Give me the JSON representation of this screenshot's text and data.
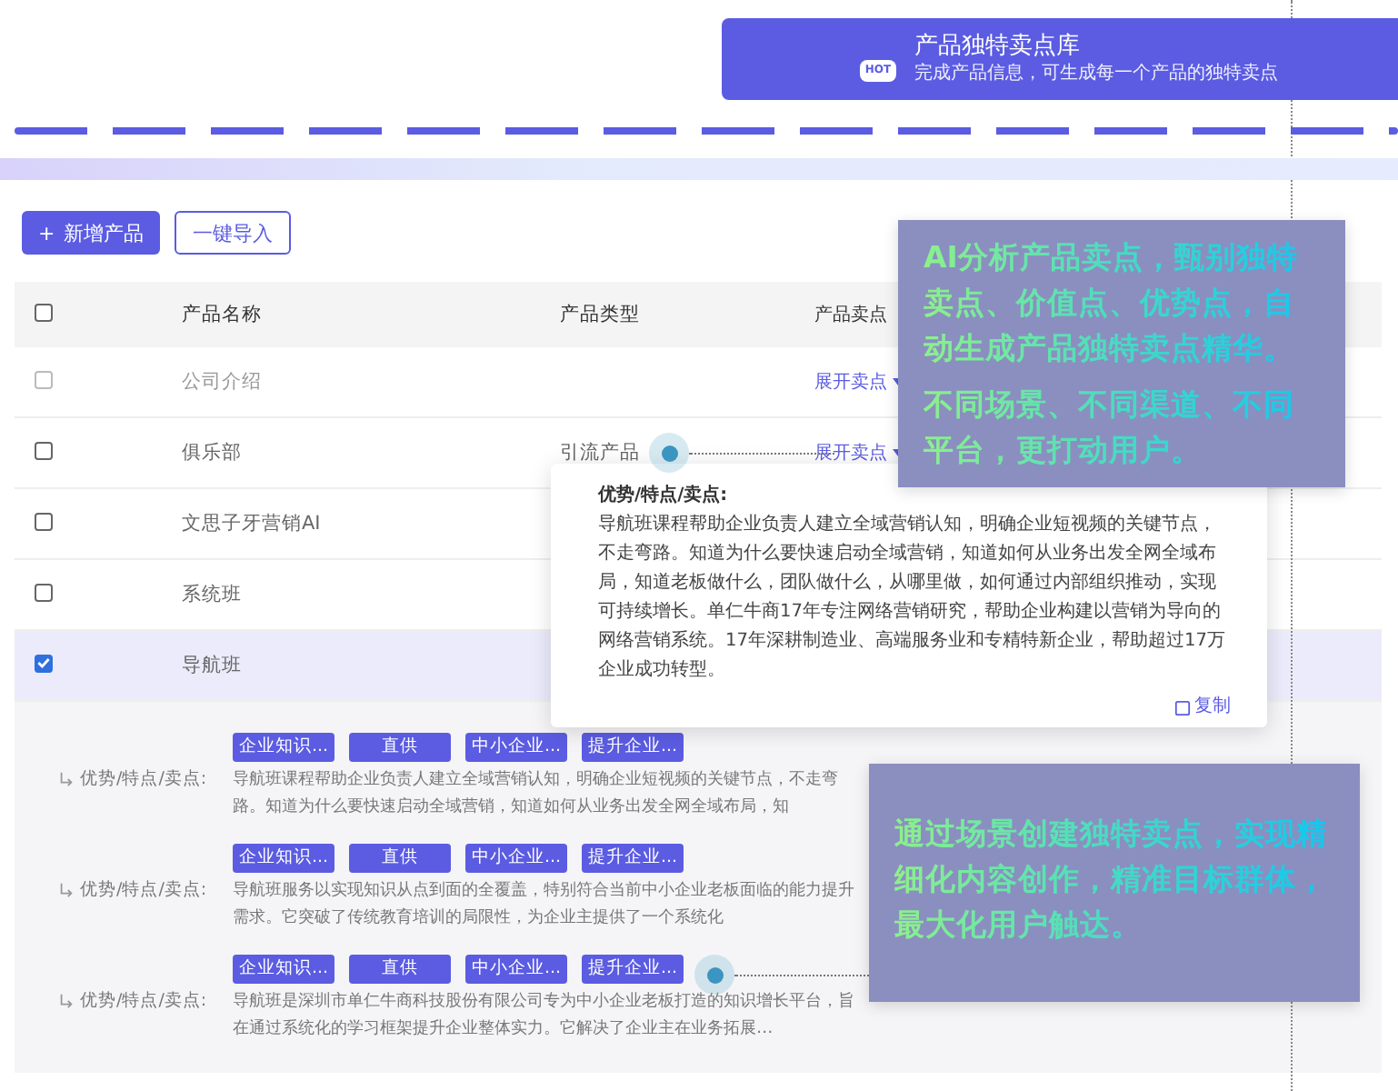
{
  "banner": {
    "title": "产品独特卖点库",
    "subtitle": "完成产品信息，可生成每一个产品的独特卖点",
    "badge": "HOT"
  },
  "toolbar": {
    "buttons": [
      {
        "label": "新增产品",
        "kind": "primary",
        "icon": "+"
      },
      {
        "label": "一键导入",
        "kind": "outline"
      }
    ]
  },
  "table": {
    "columns": [
      "产品名称",
      "产品类型",
      "产品卖点"
    ],
    "header_checked": false,
    "rows": [
      {
        "name": "公司介绍",
        "type": "",
        "action": "展开卖点",
        "checked": false,
        "disabled": true
      },
      {
        "name": "俱乐部",
        "type": "引流产品",
        "action": "展开卖点",
        "checked": false,
        "disabled": false
      },
      {
        "name": "文思子牙营销AI",
        "type": "",
        "action": "",
        "checked": false,
        "disabled": false
      },
      {
        "name": "系统班",
        "type": "",
        "action": "",
        "checked": false,
        "disabled": false
      },
      {
        "name": "导航班",
        "type": "",
        "action": "",
        "checked": true,
        "disabled": false
      }
    ],
    "details": [
      {
        "tags": [
          "企业知识...",
          "直供",
          "中小企业...",
          "提升企业..."
        ],
        "label": "优势/特点/卖点:",
        "text": "导航班课程帮助企业负责人建立全域营销认知，明确企业短视频的关键节点，不走弯路。知道为什么要快速启动全域营销，知道如何从业务出发全网全域布局，知"
      },
      {
        "tags": [
          "企业知识...",
          "直供",
          "中小企业...",
          "提升企业..."
        ],
        "label": "优势/特点/卖点:",
        "text": "导航班服务以实现知识从点到面的全覆盖，特别符合当前中小企业老板面临的能力提升需求。它突破了传统教育培训的局限性，为企业主提供了一个系统化"
      },
      {
        "tags": [
          "企业知识...",
          "直供",
          "中小企业...",
          "提升企业..."
        ],
        "label": "优势/特点/卖点:",
        "text": "导航班是深圳市单仁牛商科技股份有限公司专为中小企业老板打造的知识增长平台，旨在通过系统化的学习框架提升企业整体实力。它解决了企业主在业务拓展…"
      }
    ]
  },
  "popover": {
    "title": "优势/特点/卖点:",
    "text": "导航班课程帮助企业负责人建立全域营销认知，明确企业短视频的关键节点，不走弯路。知道为什么要快速启动全域营销，知道如何从业务出发全网全域布局，知道老板做什么，团队做什么，从哪里做，如何通过内部组织推动，实现可持续增长。单仁牛商17年专注网络营销研究，帮助企业构建以营销为导向的网络营销系统。17年深耕制造业、高端服务业和专精特新企业，帮助超过17万企业成功转型。",
    "action": "复制"
  },
  "callouts": [
    {
      "paragraphs": [
        "AI分析产品卖点，甄别独特卖点、价值点、优势点，自动生成产品独特卖点精华。",
        "不同场景、不同渠道、不同平台，更打动用户。"
      ]
    },
    {
      "paragraphs": [
        "通过场景创建独特卖点，实现精细化内容创作，精准目标群体，最大化用户触达。"
      ]
    }
  ]
}
